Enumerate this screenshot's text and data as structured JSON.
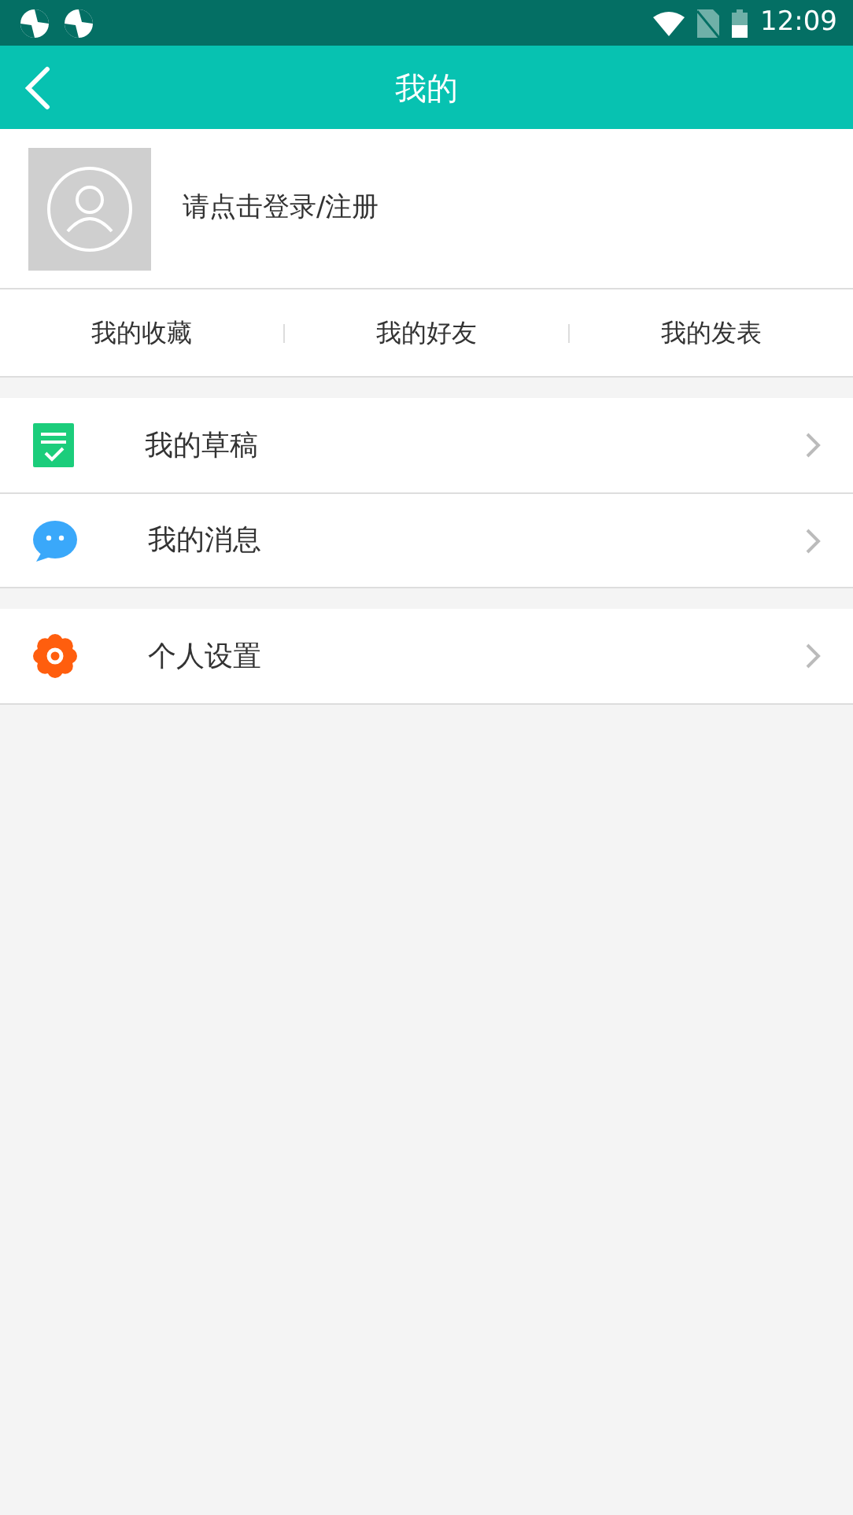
{
  "status_bar": {
    "time": "12:09"
  },
  "header": {
    "title": "我的"
  },
  "profile": {
    "login_prompt": "请点击登录/注册"
  },
  "tabs": [
    {
      "label": "我的收藏"
    },
    {
      "label": "我的好友"
    },
    {
      "label": "我的发表"
    }
  ],
  "menu_groups": [
    {
      "items": [
        {
          "kind": "draft",
          "label": "我的草稿"
        },
        {
          "kind": "message",
          "label": "我的消息"
        }
      ]
    },
    {
      "items": [
        {
          "kind": "settings",
          "label": "个人设置"
        }
      ]
    }
  ]
}
